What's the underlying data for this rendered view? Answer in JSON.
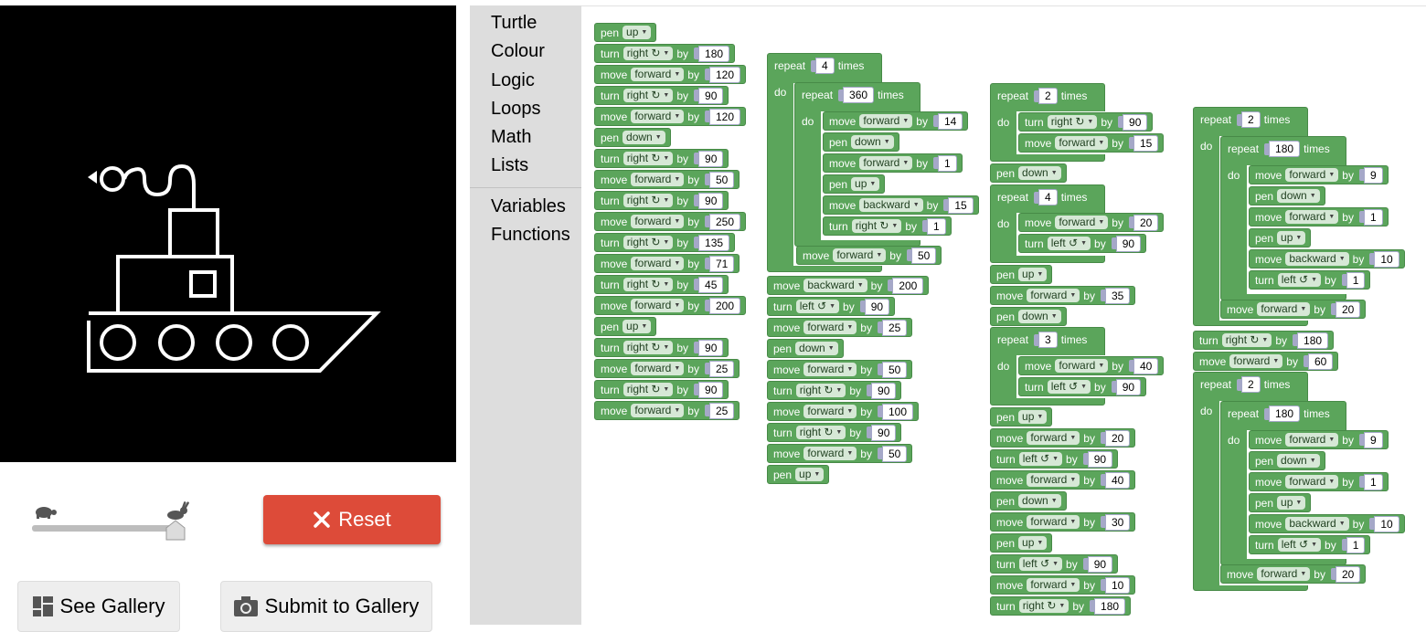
{
  "canvas": {
    "label": "drawing-canvas"
  },
  "slider": {
    "speed": 1.0
  },
  "buttons": {
    "reset": "Reset",
    "see_gallery": "See Gallery",
    "submit": "Submit to Gallery"
  },
  "toolbox": {
    "categories": [
      "Turtle",
      "Colour",
      "Logic",
      "Loops",
      "Math",
      "Lists"
    ],
    "extra": [
      "Variables",
      "Functions"
    ]
  },
  "words": {
    "pen": "pen",
    "turn": "turn",
    "move": "move",
    "by": "by",
    "repeat": "repeat",
    "times": "times",
    "do": "do"
  },
  "stack1": [
    [
      "pen",
      "up"
    ],
    [
      "turn",
      "right ↻",
      "180"
    ],
    [
      "move",
      "forward",
      "120"
    ],
    [
      "turn",
      "right ↻",
      "90"
    ],
    [
      "move",
      "forward",
      "120"
    ],
    [
      "pen",
      "down"
    ],
    [
      "turn",
      "right ↻",
      "90"
    ],
    [
      "move",
      "forward",
      "50"
    ],
    [
      "turn",
      "right ↻",
      "90"
    ],
    [
      "move",
      "forward",
      "250"
    ],
    [
      "turn",
      "right ↻",
      "135"
    ],
    [
      "move",
      "forward",
      "71"
    ],
    [
      "turn",
      "right ↻",
      "45"
    ],
    [
      "move",
      "forward",
      "200"
    ],
    [
      "pen",
      "up"
    ],
    [
      "turn",
      "right ↻",
      "90"
    ],
    [
      "move",
      "forward",
      "25"
    ],
    [
      "turn",
      "right ↻",
      "90"
    ],
    [
      "move",
      "forward",
      "25"
    ]
  ],
  "stack2": {
    "outer_times": "4",
    "inner_times": "360",
    "inner_body": [
      [
        "move",
        "forward",
        "14"
      ],
      [
        "pen",
        "down"
      ],
      [
        "move",
        "forward",
        "1"
      ],
      [
        "pen",
        "up"
      ],
      [
        "move",
        "backward",
        "15"
      ],
      [
        "turn",
        "right ↻",
        "1"
      ]
    ],
    "after_inner": [
      "move",
      "forward",
      "50"
    ],
    "after": [
      [
        "move",
        "backward",
        "200"
      ],
      [
        "turn",
        "left ↺",
        "90"
      ],
      [
        "move",
        "forward",
        "25"
      ],
      [
        "pen",
        "down"
      ],
      [
        "move",
        "forward",
        "50"
      ],
      [
        "turn",
        "right ↻",
        "90"
      ],
      [
        "move",
        "forward",
        "100"
      ],
      [
        "turn",
        "right ↻",
        "90"
      ],
      [
        "move",
        "forward",
        "50"
      ],
      [
        "pen",
        "up"
      ]
    ]
  },
  "stack3": {
    "r1_times": "2",
    "r1_body": [
      [
        "turn",
        "right ↻",
        "90"
      ],
      [
        "move",
        "forward",
        "15"
      ]
    ],
    "mid1": [
      [
        "pen",
        "down"
      ]
    ],
    "r2_times": "4",
    "r2_body": [
      [
        "move",
        "forward",
        "20"
      ],
      [
        "turn",
        "left ↺",
        "90"
      ]
    ],
    "mid2": [
      [
        "pen",
        "up"
      ],
      [
        "move",
        "forward",
        "35"
      ],
      [
        "pen",
        "down"
      ]
    ],
    "r3_times": "3",
    "r3_body": [
      [
        "move",
        "forward",
        "40"
      ],
      [
        "turn",
        "left ↺",
        "90"
      ]
    ],
    "after": [
      [
        "pen",
        "up"
      ],
      [
        "move",
        "forward",
        "20"
      ],
      [
        "turn",
        "left ↺",
        "90"
      ],
      [
        "move",
        "forward",
        "40"
      ],
      [
        "pen",
        "down"
      ],
      [
        "move",
        "forward",
        "30"
      ],
      [
        "pen",
        "up"
      ],
      [
        "turn",
        "left ↺",
        "90"
      ],
      [
        "move",
        "forward",
        "10"
      ],
      [
        "turn",
        "right ↻",
        "180"
      ]
    ]
  },
  "stack4": {
    "a_times": "2",
    "a_inner_times": "180",
    "a_inner_body": [
      [
        "move",
        "forward",
        "9"
      ],
      [
        "pen",
        "down"
      ],
      [
        "move",
        "forward",
        "1"
      ],
      [
        "pen",
        "up"
      ],
      [
        "move",
        "backward",
        "10"
      ],
      [
        "turn",
        "left ↺",
        "1"
      ]
    ],
    "a_after": [
      "move",
      "forward",
      "20"
    ],
    "mid": [
      [
        "turn",
        "right ↻",
        "180"
      ],
      [
        "move",
        "forward",
        "60"
      ]
    ],
    "b_times": "2",
    "b_inner_times": "180",
    "b_inner_body": [
      [
        "move",
        "forward",
        "9"
      ],
      [
        "pen",
        "down"
      ],
      [
        "move",
        "forward",
        "1"
      ],
      [
        "pen",
        "up"
      ],
      [
        "move",
        "backward",
        "10"
      ],
      [
        "turn",
        "left ↺",
        "1"
      ]
    ],
    "b_after": [
      "move",
      "forward",
      "20"
    ]
  }
}
